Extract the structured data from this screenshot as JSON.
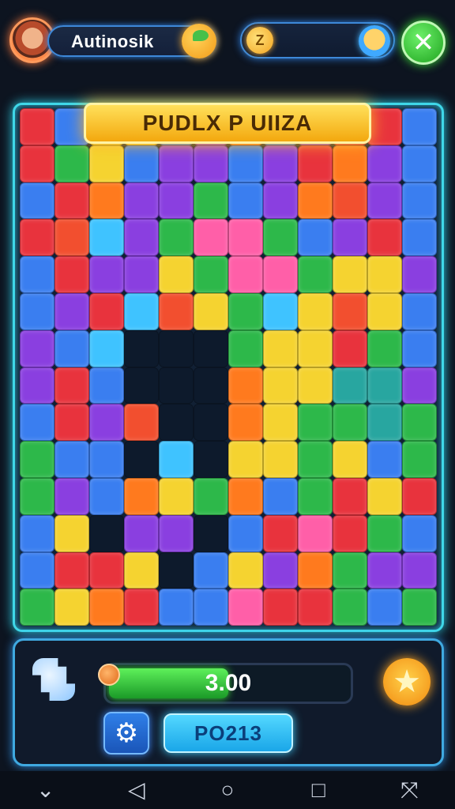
{
  "header": {
    "player_name": "Autinosik",
    "coin_symbol": "Z",
    "close_label": "✕",
    "icons": {
      "avatar": "player-avatar",
      "chat": "chat-bubble-icon",
      "coin": "coin-icon",
      "companion": "companion-face-icon",
      "close": "close-icon"
    }
  },
  "board": {
    "title": "PUDLX P UIIZA",
    "columns": 12,
    "rows": 14,
    "palette": [
      "#e8333d",
      "#3a7ef0",
      "#8a3fe0",
      "#f5d330",
      "#2db84a",
      "#ff7a1e",
      "#3fc3ff",
      "#ff5fa8",
      "#28a6a0",
      "#f24f2f"
    ],
    "tiles": [
      0,
      1,
      3,
      3,
      1,
      2,
      5,
      1,
      2,
      0,
      0,
      1,
      0,
      4,
      3,
      1,
      2,
      2,
      1,
      2,
      0,
      5,
      2,
      1,
      1,
      0,
      5,
      2,
      2,
      4,
      1,
      2,
      5,
      9,
      2,
      1,
      0,
      9,
      6,
      2,
      4,
      7,
      7,
      4,
      1,
      2,
      0,
      1,
      1,
      0,
      2,
      2,
      3,
      4,
      7,
      7,
      4,
      3,
      3,
      2,
      1,
      2,
      0,
      6,
      9,
      3,
      4,
      6,
      3,
      9,
      3,
      1,
      2,
      1,
      6,
      -1,
      -1,
      -1,
      4,
      3,
      3,
      0,
      4,
      1,
      2,
      0,
      1,
      -1,
      -1,
      -1,
      5,
      3,
      3,
      8,
      8,
      2,
      1,
      0,
      2,
      9,
      -1,
      -1,
      5,
      3,
      4,
      4,
      8,
      4,
      4,
      1,
      1,
      -1,
      6,
      -1,
      3,
      3,
      4,
      3,
      1,
      4,
      4,
      2,
      1,
      5,
      3,
      4,
      5,
      1,
      4,
      0,
      3,
      0,
      1,
      3,
      -1,
      2,
      2,
      -1,
      1,
      0,
      7,
      0,
      4,
      1,
      1,
      0,
      0,
      3,
      -1,
      1,
      3,
      2,
      5,
      4,
      2,
      2,
      4,
      3,
      5,
      0,
      1,
      1,
      7,
      0,
      0,
      4,
      1,
      4
    ]
  },
  "panel": {
    "progress_value": "3.00",
    "progress_fraction": 0.5,
    "code_label": "PO213",
    "gear_label": "⚙",
    "star_label": "★",
    "icons": {
      "piece": "puzzle-piece-icon",
      "gear": "gear-icon",
      "star": "star-icon"
    }
  },
  "nav": {
    "back": "◁",
    "home": "○",
    "recents": "□",
    "down": "⌄",
    "extra": "⤧"
  }
}
